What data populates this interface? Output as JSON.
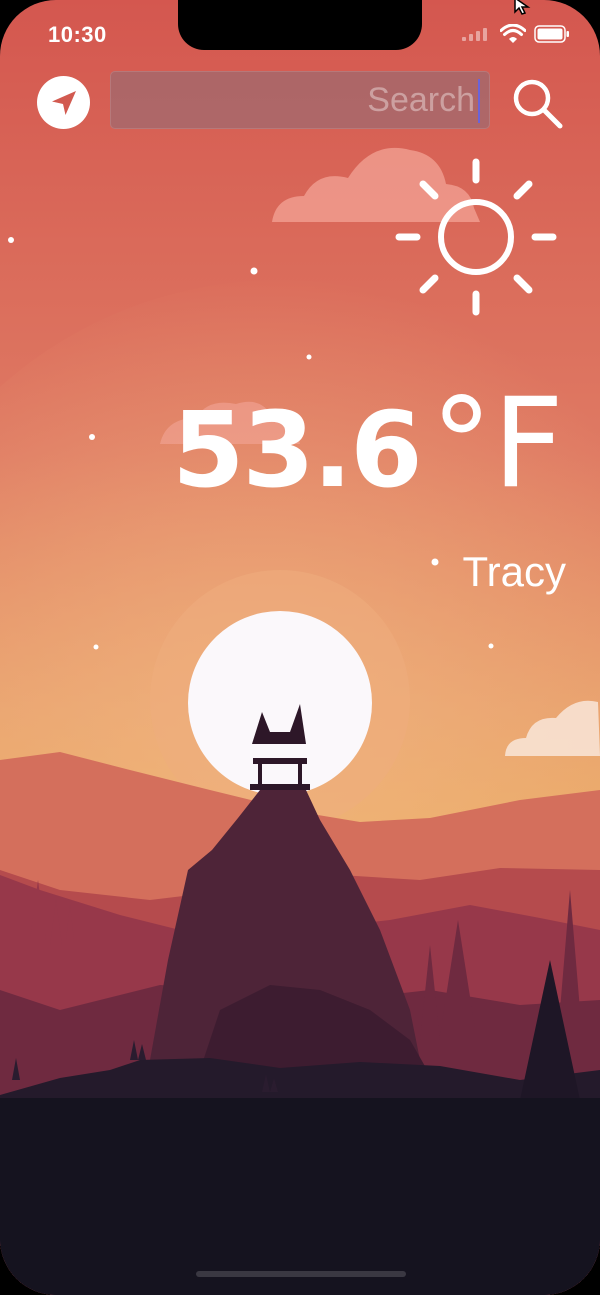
{
  "status_bar": {
    "time": "10:30"
  },
  "header": {
    "location_icon": "navigation-arrow-icon",
    "search": {
      "placeholder": "Search",
      "value": ""
    },
    "search_icon": "magnifier-icon"
  },
  "weather": {
    "condition_icon": "sun-icon",
    "temperature": "53.6",
    "unit": "°F",
    "city": "Tracy"
  },
  "colors": {
    "sky_top": "#d4574f",
    "sky_bottom": "#ecb064",
    "sun_disc": "#fbf8fb",
    "ground": "#15131f"
  }
}
